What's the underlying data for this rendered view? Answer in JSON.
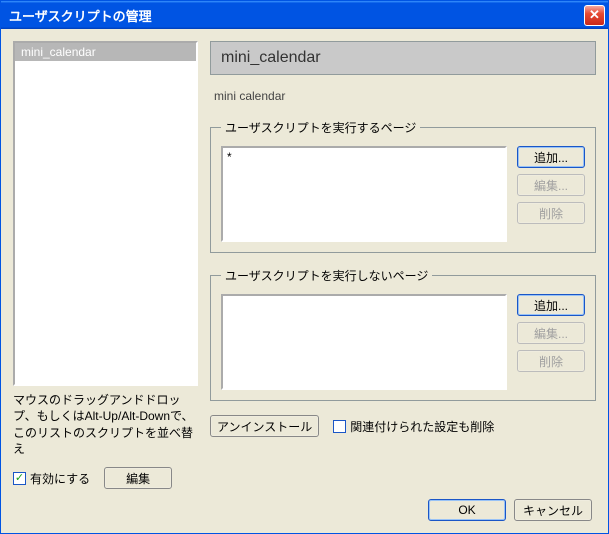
{
  "window": {
    "title": "ユーザスクリプトの管理"
  },
  "left": {
    "items": [
      "mini_calendar"
    ],
    "hint": "マウスのドラッグアンドドロップ、もしくはAlt-Up/Alt-Downで、このリストのスクリプトを並べ替え",
    "enable_label": "有効にする",
    "enable_checked": true,
    "edit_label": "編集"
  },
  "right": {
    "script_title": "mini_calendar",
    "script_subtitle": "mini calendar",
    "include": {
      "legend": "ユーザスクリプトを実行するページ",
      "items": [
        "*"
      ],
      "add": "追加...",
      "edit": "編集...",
      "remove": "削除"
    },
    "exclude": {
      "legend": "ユーザスクリプトを実行しないページ",
      "items": [],
      "add": "追加...",
      "edit": "編集...",
      "remove": "削除"
    },
    "uninstall_label": "アンインストール",
    "delete_assoc_label": "関連付けられた設定も削除",
    "delete_assoc_checked": false
  },
  "footer": {
    "ok": "OK",
    "cancel": "キャンセル"
  }
}
